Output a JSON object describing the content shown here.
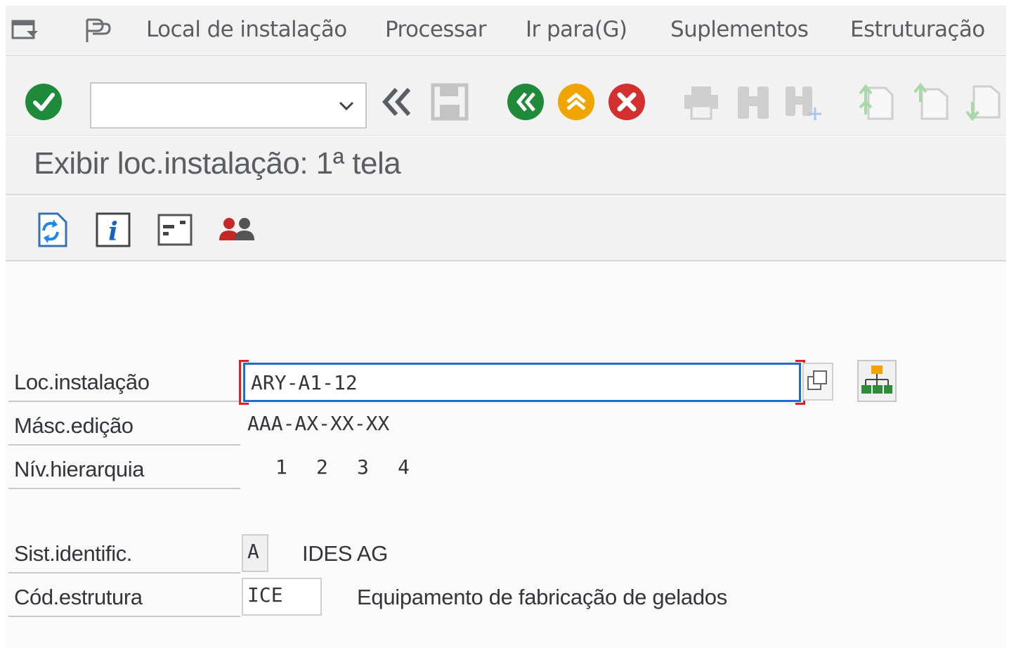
{
  "menu": {
    "items": [
      "Local de instalação",
      "Processar",
      "Ir para(G)",
      "Suplementos",
      "Estruturação"
    ]
  },
  "toolbar": {
    "command_value": ""
  },
  "title": "Exibir loc.instalação: 1ª tela",
  "form": {
    "loc_label": "Loc.instalação",
    "loc_value": "ARY-A1-12",
    "masc_label": "Másc.edição",
    "masc_value": "AAA-AX-XX-XX",
    "niv_label": "Nív.hierarquia",
    "niv_values": [
      "1",
      "2",
      "3",
      "4"
    ],
    "sist_label": "Sist.identific.",
    "sist_value": "A",
    "sist_desc": "IDES AG",
    "cod_label": "Cód.estrutura",
    "cod_value": "ICE",
    "cod_desc": "Equipamento de fabricação de gelados"
  },
  "colors": {
    "accent": "#1c6ed0",
    "ok_green": "#1f8a3a",
    "exit_orange": "#f0a500",
    "cancel_red": "#d32f2f"
  },
  "icons": [
    "menu-icon",
    "display-mode-icon",
    "enter-icon",
    "dropdown-icon",
    "back-double-icon",
    "save-icon",
    "back-icon",
    "exit-icon",
    "cancel-icon",
    "print-icon",
    "find-icon",
    "find-next-icon",
    "first-page-icon",
    "previous-page-icon",
    "next-page-icon",
    "refresh-icon",
    "info-icon",
    "hierarchy-icon",
    "users-icon",
    "copy-icon",
    "structure-icon"
  ]
}
